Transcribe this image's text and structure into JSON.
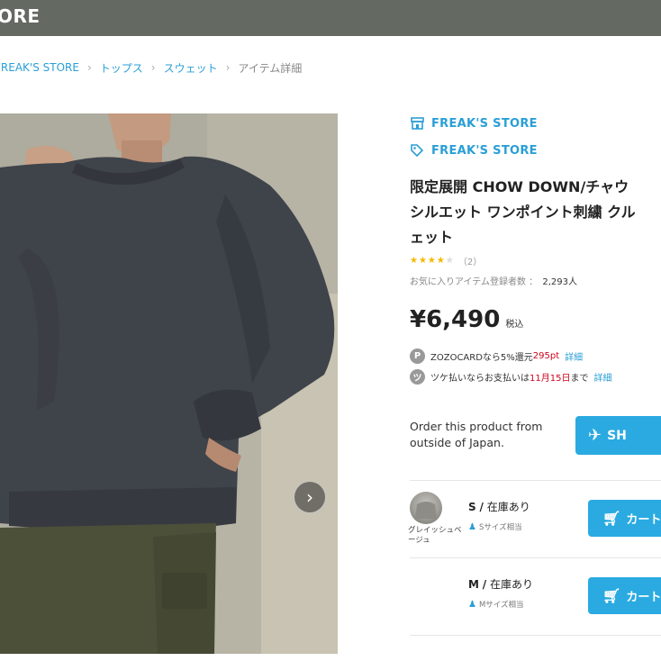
{
  "header": {
    "logo_text": "ORE"
  },
  "breadcrumb": [
    {
      "label": "FREAK'S STORE"
    },
    {
      "label": "トップス"
    },
    {
      "label": "スウェット"
    },
    {
      "label": "アイテム詳細"
    }
  ],
  "gallery": {
    "next_icon": "chevron-right-icon"
  },
  "product": {
    "shop_name": "FREAK'S STORE",
    "brand_name": "FREAK'S STORE",
    "title_line1": "限定展開 CHOW DOWN/チャウ",
    "title_line2": "シルエット ワンポイント刺繍 クル",
    "title_line3": "ェット",
    "rating_value": 4,
    "rating_max": 5,
    "review_count": "（2）",
    "favorites_label": "お気に入りアイテム登録者数 ：",
    "favorites_count": "2,293人",
    "price": "¥6,490",
    "tax_label": "税込"
  },
  "promotions": {
    "zozocard": {
      "badge": "P",
      "text": "ZOZOCARDなら5%還元",
      "points": "295pt",
      "link": "詳細"
    },
    "tsuke": {
      "badge": "ツ",
      "text_before": "ツケ払いならお支払いは",
      "date": "11月15日",
      "text_after": "まで",
      "link": "詳細"
    }
  },
  "international": {
    "text": "Order this product from outside of Japan.",
    "button_label": "SH"
  },
  "variants": [
    {
      "color": "グレイッシュベージュ",
      "size": "S",
      "stock": "在庫あり",
      "fit": "Sサイズ相当",
      "cart_label": "カート"
    },
    {
      "color": "",
      "size": "M",
      "stock": "在庫あり",
      "fit": "Mサイズ相当",
      "cart_label": "カート"
    }
  ],
  "colors": {
    "accent": "#2aaae1",
    "link": "#2a9fd6",
    "header_bg": "#646961",
    "price_red": "#d0021b",
    "star": "#f5b800"
  }
}
